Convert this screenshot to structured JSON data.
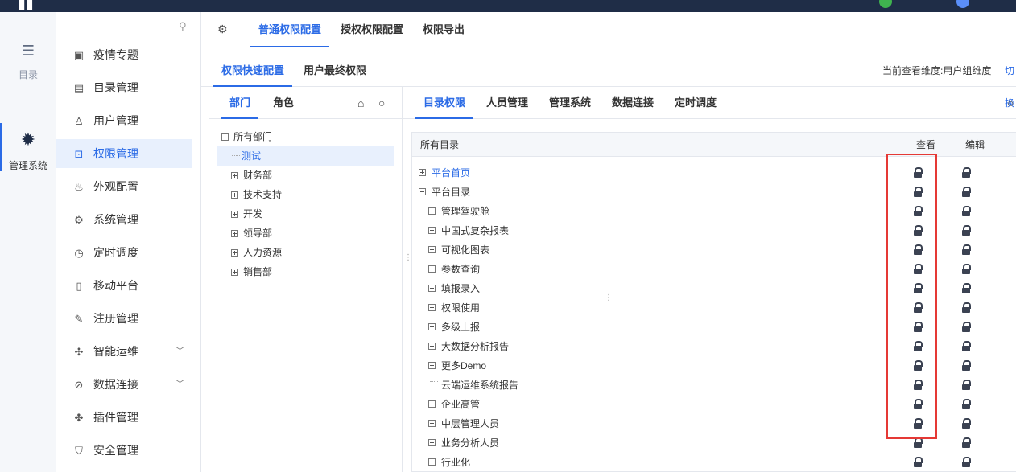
{
  "rail": [
    {
      "label": "目录",
      "icon": "list-icon"
    },
    {
      "label": "管理系统",
      "icon": "gear-icon"
    }
  ],
  "menu": [
    {
      "label": "疫情专题",
      "icon": "monitor-icon"
    },
    {
      "label": "目录管理",
      "icon": "list-icon"
    },
    {
      "label": "用户管理",
      "icon": "user-icon"
    },
    {
      "label": "权限管理",
      "icon": "lock-icon"
    },
    {
      "label": "外观配置",
      "icon": "brush-icon"
    },
    {
      "label": "系统管理",
      "icon": "gear-icon"
    },
    {
      "label": "定时调度",
      "icon": "timer-icon"
    },
    {
      "label": "移动平台",
      "icon": "mobile-icon"
    },
    {
      "label": "注册管理",
      "icon": "register-icon"
    },
    {
      "label": "智能运维",
      "icon": "network-icon"
    },
    {
      "label": "数据连接",
      "icon": "link-icon"
    },
    {
      "label": "插件管理",
      "icon": "puzzle-icon"
    },
    {
      "label": "安全管理",
      "icon": "shield-icon"
    }
  ],
  "top_tabs": [
    "普通权限配置",
    "授权权限配置",
    "权限导出"
  ],
  "sub_tabs": [
    "权限快速配置",
    "用户最终权限"
  ],
  "dimension_info": "当前查看维度:用户组维度",
  "switch_label": "切换",
  "left_tabs": [
    "部门",
    "角色"
  ],
  "dept_tree": {
    "root": "所有部门",
    "children": [
      "测试",
      "财务部",
      "技术支持",
      "开发",
      "领导部",
      "人力资源",
      "销售部"
    ]
  },
  "right_tabs": [
    "目录权限",
    "人员管理",
    "管理系统",
    "数据连接",
    "定时调度"
  ],
  "grid": {
    "col_name": "所有目录",
    "col_view": "查看",
    "col_edit": "编辑",
    "rows": [
      {
        "label": "平台首页",
        "level": 0,
        "expander": "plus",
        "link": true
      },
      {
        "label": "平台目录",
        "level": 0,
        "expander": "minus",
        "link": false
      },
      {
        "label": "管理驾驶舱",
        "level": 1,
        "expander": "plus",
        "link": false
      },
      {
        "label": "中国式复杂报表",
        "level": 1,
        "expander": "plus",
        "link": false
      },
      {
        "label": "可视化图表",
        "level": 1,
        "expander": "plus",
        "link": false
      },
      {
        "label": "参数查询",
        "level": 1,
        "expander": "plus",
        "link": false
      },
      {
        "label": "填报录入",
        "level": 1,
        "expander": "plus",
        "link": false
      },
      {
        "label": "权限使用",
        "level": 1,
        "expander": "plus",
        "link": false
      },
      {
        "label": "多级上报",
        "level": 1,
        "expander": "plus",
        "link": false
      },
      {
        "label": "大数据分析报告",
        "level": 1,
        "expander": "plus",
        "link": false
      },
      {
        "label": "更多Demo",
        "level": 1,
        "expander": "plus",
        "link": false
      },
      {
        "label": "云端运维系统报告",
        "level": 1,
        "expander": "none",
        "link": false
      },
      {
        "label": "企业高管",
        "level": 1,
        "expander": "plus",
        "link": false
      },
      {
        "label": "中层管理人员",
        "level": 1,
        "expander": "plus",
        "link": false
      },
      {
        "label": "业务分析人员",
        "level": 1,
        "expander": "plus",
        "link": false
      },
      {
        "label": "行业化",
        "level": 1,
        "expander": "plus",
        "link": false
      }
    ]
  },
  "colors": {
    "accent": "#2b6be6",
    "highlight": "#e53935"
  }
}
